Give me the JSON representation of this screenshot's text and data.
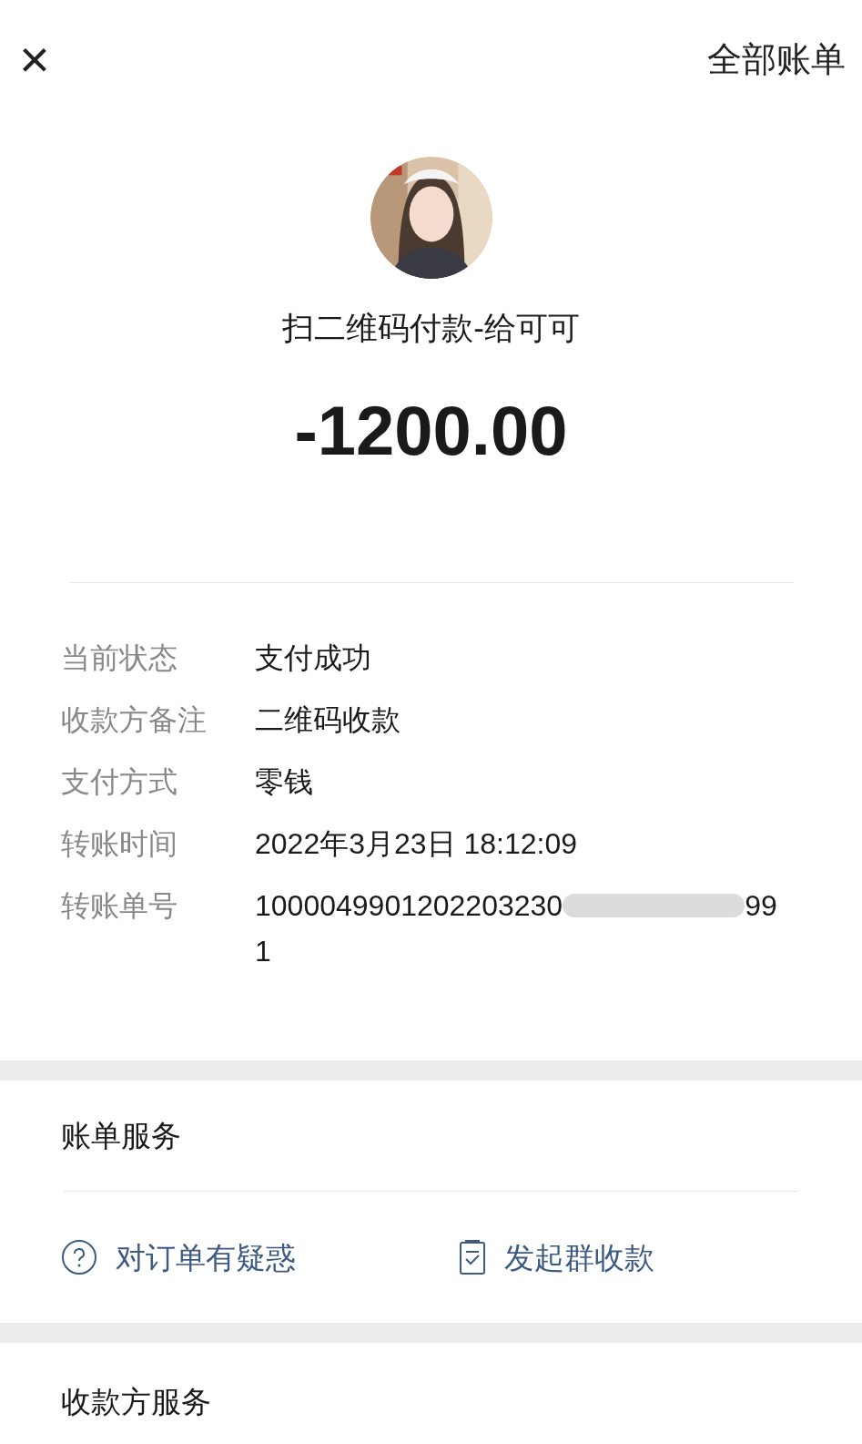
{
  "header": {
    "close": "×",
    "all_bills": "全部账单"
  },
  "title": "扫二维码付款-给可可",
  "amount": "-1200.00",
  "details": [
    {
      "label": "当前状态",
      "value": "支付成功"
    },
    {
      "label": "收款方备注",
      "value": "二维码收款"
    },
    {
      "label": "支付方式",
      "value": "零钱"
    },
    {
      "label": "转账时间",
      "value": "2022年3月23日 18:12:09"
    },
    {
      "label": "转账单号",
      "value_start": "1000049901202203230",
      "value_end": "99",
      "value_wrap": "1",
      "redacted": true
    }
  ],
  "bill_services": {
    "title": "账单服务",
    "actions": [
      {
        "kind": "question",
        "label": "对订单有疑惑"
      },
      {
        "kind": "document",
        "label": "发起群收款"
      }
    ]
  },
  "payee_services": {
    "title": "收款方服务"
  }
}
